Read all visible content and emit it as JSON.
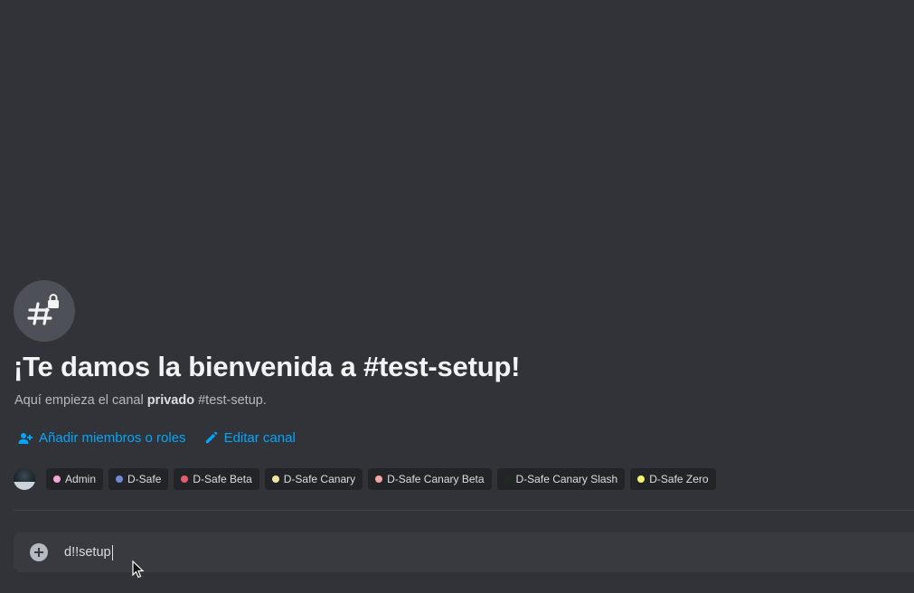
{
  "welcome": {
    "title": "¡Te damos la bienvenida a #test-setup!",
    "subtitle_prefix": "Aquí empieza el canal ",
    "subtitle_bold": "privado",
    "subtitle_suffix": " #test-setup."
  },
  "actions": {
    "add_members": "Añadir miembros o roles",
    "edit_channel": "Editar canal"
  },
  "roles": [
    {
      "name": "Admin",
      "color": "#f4a6d7"
    },
    {
      "name": "D-Safe",
      "color": "#7289da"
    },
    {
      "name": "D-Safe Beta",
      "color": "#e35d6a"
    },
    {
      "name": "D-Safe Canary",
      "color": "#f1e3a0"
    },
    {
      "name": "D-Safe Canary Beta",
      "color": "#f4a6a6"
    },
    {
      "name": "D-Safe Canary Slash",
      "color": "#1f2a22"
    },
    {
      "name": "D-Safe Zero",
      "color": "#f5f36b"
    }
  ],
  "composer": {
    "value": "d!!setup"
  },
  "colors": {
    "accent_link": "#00a8fc",
    "background": "#313338"
  }
}
